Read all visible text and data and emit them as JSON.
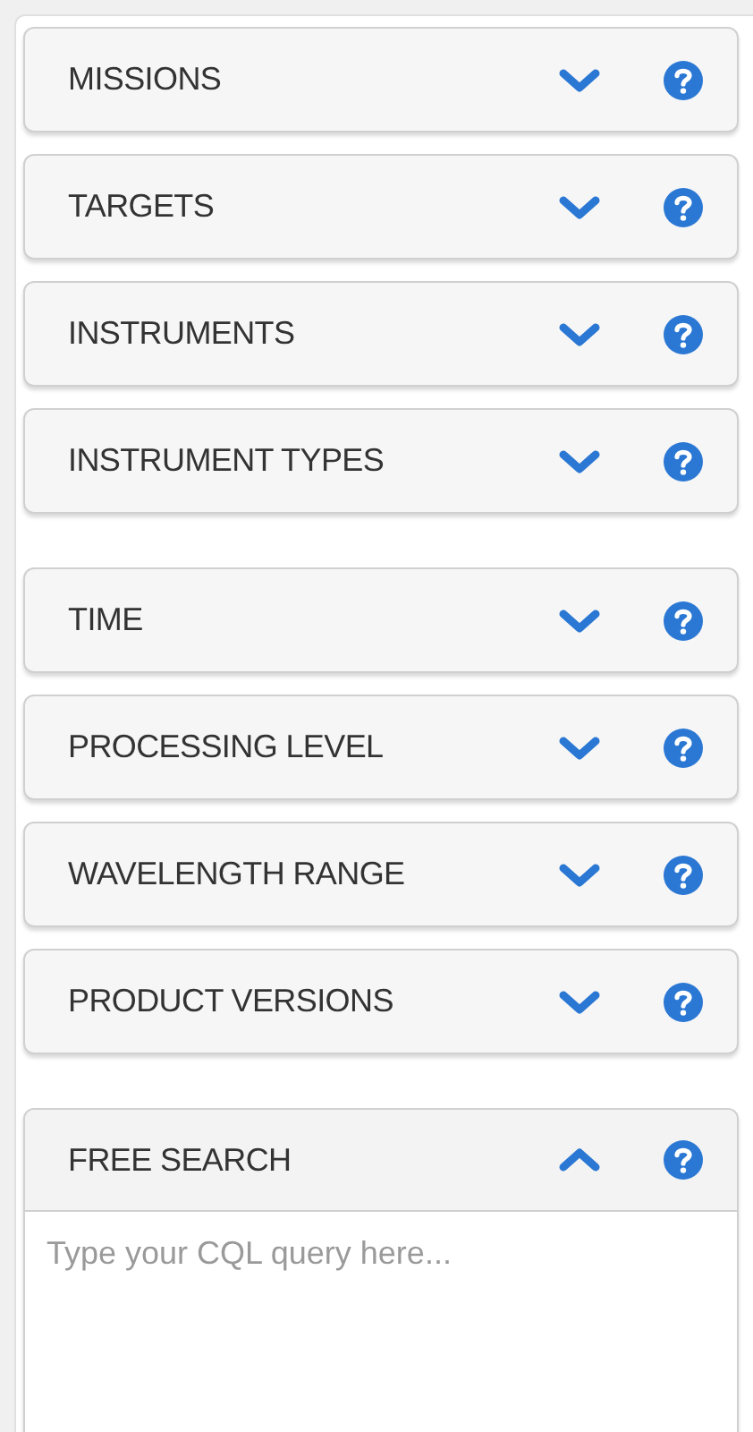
{
  "groups": [
    {
      "panels": [
        {
          "title": "MISSIONS",
          "expanded": false
        },
        {
          "title": "TARGETS",
          "expanded": false
        },
        {
          "title": "INSTRUMENTS",
          "expanded": false
        },
        {
          "title": "INSTRUMENT TYPES",
          "expanded": false
        }
      ]
    },
    {
      "panels": [
        {
          "title": "TIME",
          "expanded": false
        },
        {
          "title": "PROCESSING LEVEL",
          "expanded": false
        },
        {
          "title": "WAVELENGTH RANGE",
          "expanded": false
        },
        {
          "title": "PRODUCT VERSIONS",
          "expanded": false
        }
      ]
    },
    {
      "panels": [
        {
          "title": "FREE SEARCH",
          "expanded": true,
          "placeholder": "Type your CQL query here..."
        }
      ]
    }
  ]
}
